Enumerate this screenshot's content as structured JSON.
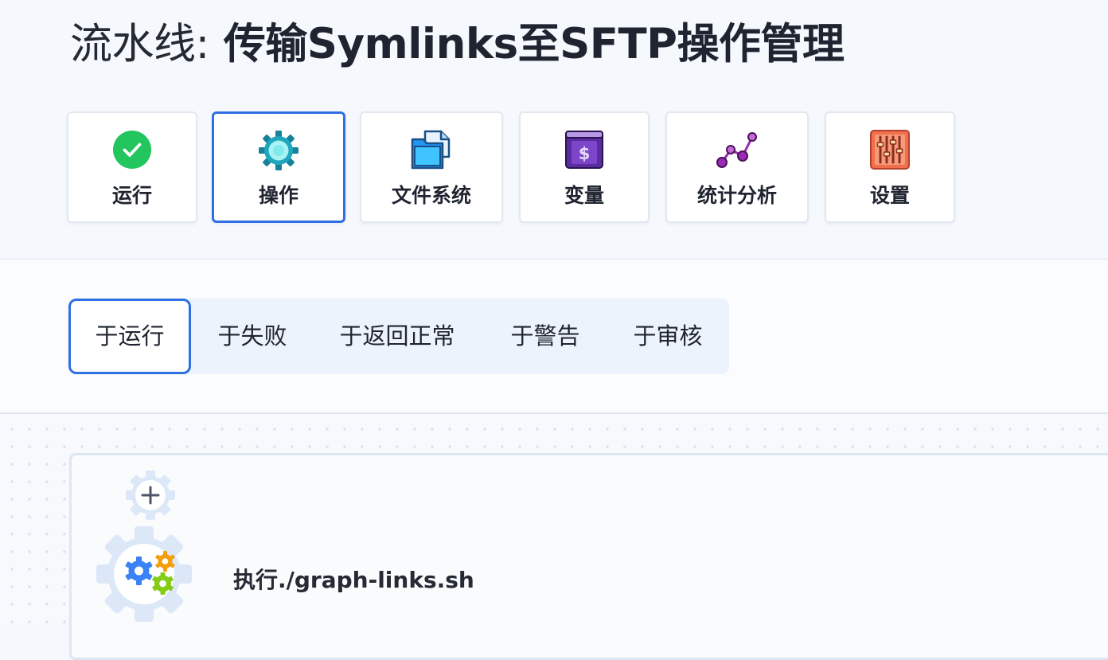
{
  "title": {
    "prefix": "流水线:",
    "name": "传输Symlinks至SFTP操作管理"
  },
  "nav": [
    {
      "label": "运行",
      "icon": "check-circle-icon",
      "active": false
    },
    {
      "label": "操作",
      "icon": "gear-icon",
      "active": true
    },
    {
      "label": "文件系统",
      "icon": "folder-file-icon",
      "active": false
    },
    {
      "label": "变量",
      "icon": "dollar-variable-icon",
      "active": false
    },
    {
      "label": "统计分析",
      "icon": "line-chart-icon",
      "active": false
    },
    {
      "label": "设置",
      "icon": "sliders-icon",
      "active": false
    }
  ],
  "tabs": [
    {
      "label": "于运行",
      "active": true
    },
    {
      "label": "于失败",
      "active": false
    },
    {
      "label": "于返回正常",
      "active": false
    },
    {
      "label": "于警告",
      "active": false
    },
    {
      "label": "于审核",
      "active": false
    }
  ],
  "action": {
    "label": "执行./graph-links.sh",
    "icon": "gears-icon"
  },
  "add_action_icon": "add-gear-icon",
  "colors": {
    "accent": "#2f6fe5",
    "success": "#22c55e",
    "teal": "#21a7bd",
    "file_blue": "#2196f3",
    "variable_purple": "#5b2c9f",
    "analytics_purple": "#9b2ab7",
    "settings_orange": "#f26f4d"
  }
}
